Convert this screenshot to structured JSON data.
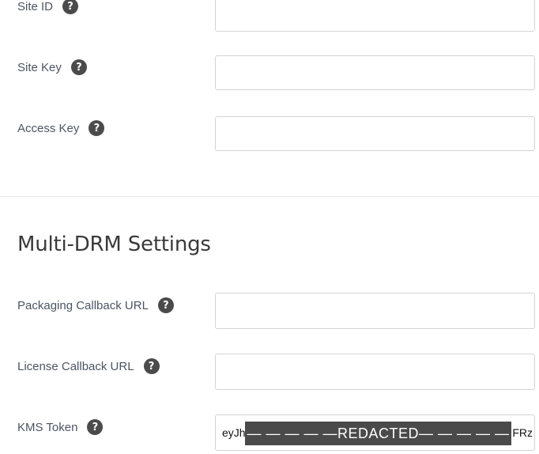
{
  "top_fields": [
    {
      "label": "Site ID",
      "value": ""
    },
    {
      "label": "Site Key",
      "value": ""
    },
    {
      "label": "Access Key",
      "value": ""
    }
  ],
  "section": {
    "title": "Multi-DRM Settings"
  },
  "drm_fields": [
    {
      "label": "Packaging Callback URL",
      "value": ""
    },
    {
      "label": "License Callback URL",
      "value": ""
    }
  ],
  "kms": {
    "label": "KMS Token",
    "value_start": "eyJh",
    "redacted_text": "— — — — —REDACTED— — — — —",
    "value_end": "FRz"
  },
  "icons": {
    "help": "question-circle-icon",
    "help_glyph": "?"
  }
}
